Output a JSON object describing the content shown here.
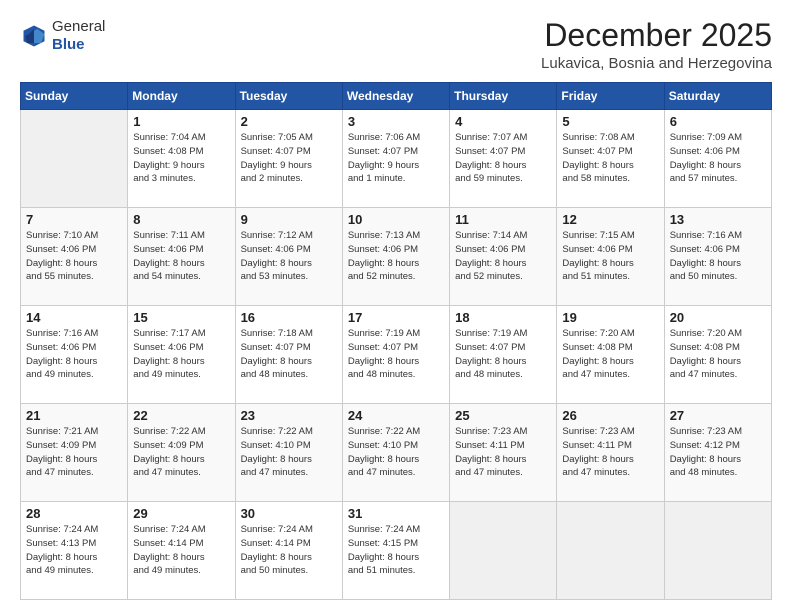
{
  "header": {
    "logo_line1": "General",
    "logo_line2": "Blue",
    "title": "December 2025",
    "subtitle": "Lukavica, Bosnia and Herzegovina"
  },
  "days_of_week": [
    "Sunday",
    "Monday",
    "Tuesday",
    "Wednesday",
    "Thursday",
    "Friday",
    "Saturday"
  ],
  "weeks": [
    [
      {
        "day": "",
        "info": ""
      },
      {
        "day": "1",
        "info": "Sunrise: 7:04 AM\nSunset: 4:08 PM\nDaylight: 9 hours\nand 3 minutes."
      },
      {
        "day": "2",
        "info": "Sunrise: 7:05 AM\nSunset: 4:07 PM\nDaylight: 9 hours\nand 2 minutes."
      },
      {
        "day": "3",
        "info": "Sunrise: 7:06 AM\nSunset: 4:07 PM\nDaylight: 9 hours\nand 1 minute."
      },
      {
        "day": "4",
        "info": "Sunrise: 7:07 AM\nSunset: 4:07 PM\nDaylight: 8 hours\nand 59 minutes."
      },
      {
        "day": "5",
        "info": "Sunrise: 7:08 AM\nSunset: 4:07 PM\nDaylight: 8 hours\nand 58 minutes."
      },
      {
        "day": "6",
        "info": "Sunrise: 7:09 AM\nSunset: 4:06 PM\nDaylight: 8 hours\nand 57 minutes."
      }
    ],
    [
      {
        "day": "7",
        "info": "Sunrise: 7:10 AM\nSunset: 4:06 PM\nDaylight: 8 hours\nand 55 minutes."
      },
      {
        "day": "8",
        "info": "Sunrise: 7:11 AM\nSunset: 4:06 PM\nDaylight: 8 hours\nand 54 minutes."
      },
      {
        "day": "9",
        "info": "Sunrise: 7:12 AM\nSunset: 4:06 PM\nDaylight: 8 hours\nand 53 minutes."
      },
      {
        "day": "10",
        "info": "Sunrise: 7:13 AM\nSunset: 4:06 PM\nDaylight: 8 hours\nand 52 minutes."
      },
      {
        "day": "11",
        "info": "Sunrise: 7:14 AM\nSunset: 4:06 PM\nDaylight: 8 hours\nand 52 minutes."
      },
      {
        "day": "12",
        "info": "Sunrise: 7:15 AM\nSunset: 4:06 PM\nDaylight: 8 hours\nand 51 minutes."
      },
      {
        "day": "13",
        "info": "Sunrise: 7:16 AM\nSunset: 4:06 PM\nDaylight: 8 hours\nand 50 minutes."
      }
    ],
    [
      {
        "day": "14",
        "info": "Sunrise: 7:16 AM\nSunset: 4:06 PM\nDaylight: 8 hours\nand 49 minutes."
      },
      {
        "day": "15",
        "info": "Sunrise: 7:17 AM\nSunset: 4:06 PM\nDaylight: 8 hours\nand 49 minutes."
      },
      {
        "day": "16",
        "info": "Sunrise: 7:18 AM\nSunset: 4:07 PM\nDaylight: 8 hours\nand 48 minutes."
      },
      {
        "day": "17",
        "info": "Sunrise: 7:19 AM\nSunset: 4:07 PM\nDaylight: 8 hours\nand 48 minutes."
      },
      {
        "day": "18",
        "info": "Sunrise: 7:19 AM\nSunset: 4:07 PM\nDaylight: 8 hours\nand 48 minutes."
      },
      {
        "day": "19",
        "info": "Sunrise: 7:20 AM\nSunset: 4:08 PM\nDaylight: 8 hours\nand 47 minutes."
      },
      {
        "day": "20",
        "info": "Sunrise: 7:20 AM\nSunset: 4:08 PM\nDaylight: 8 hours\nand 47 minutes."
      }
    ],
    [
      {
        "day": "21",
        "info": "Sunrise: 7:21 AM\nSunset: 4:09 PM\nDaylight: 8 hours\nand 47 minutes."
      },
      {
        "day": "22",
        "info": "Sunrise: 7:22 AM\nSunset: 4:09 PM\nDaylight: 8 hours\nand 47 minutes."
      },
      {
        "day": "23",
        "info": "Sunrise: 7:22 AM\nSunset: 4:10 PM\nDaylight: 8 hours\nand 47 minutes."
      },
      {
        "day": "24",
        "info": "Sunrise: 7:22 AM\nSunset: 4:10 PM\nDaylight: 8 hours\nand 47 minutes."
      },
      {
        "day": "25",
        "info": "Sunrise: 7:23 AM\nSunset: 4:11 PM\nDaylight: 8 hours\nand 47 minutes."
      },
      {
        "day": "26",
        "info": "Sunrise: 7:23 AM\nSunset: 4:11 PM\nDaylight: 8 hours\nand 47 minutes."
      },
      {
        "day": "27",
        "info": "Sunrise: 7:23 AM\nSunset: 4:12 PM\nDaylight: 8 hours\nand 48 minutes."
      }
    ],
    [
      {
        "day": "28",
        "info": "Sunrise: 7:24 AM\nSunset: 4:13 PM\nDaylight: 8 hours\nand 49 minutes."
      },
      {
        "day": "29",
        "info": "Sunrise: 7:24 AM\nSunset: 4:14 PM\nDaylight: 8 hours\nand 49 minutes."
      },
      {
        "day": "30",
        "info": "Sunrise: 7:24 AM\nSunset: 4:14 PM\nDaylight: 8 hours\nand 50 minutes."
      },
      {
        "day": "31",
        "info": "Sunrise: 7:24 AM\nSunset: 4:15 PM\nDaylight: 8 hours\nand 51 minutes."
      },
      {
        "day": "",
        "info": ""
      },
      {
        "day": "",
        "info": ""
      },
      {
        "day": "",
        "info": ""
      }
    ]
  ]
}
